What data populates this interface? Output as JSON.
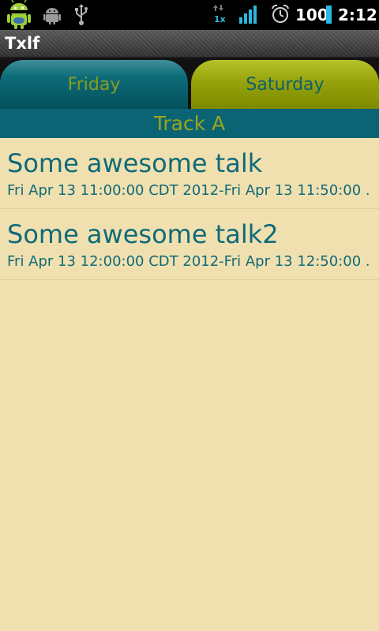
{
  "status_bar": {
    "battery": "100",
    "time": "2:12",
    "icons": [
      "android-notification-icon",
      "android-debug-icon",
      "usb-icon",
      "data-transfer-icon",
      "signal-bars-icon",
      "alarm-clock-icon",
      "battery-icon"
    ]
  },
  "app": {
    "title": "Txlf"
  },
  "tabs": [
    {
      "label": "Friday",
      "selected": false
    },
    {
      "label": "Saturday",
      "selected": true
    }
  ],
  "track": {
    "name": "Track A"
  },
  "talks": [
    {
      "title": "Some awesome talk",
      "time": "Fri Apr 13 11:00:00 CDT 2012-Fri Apr 13 11:50:00 ..."
    },
    {
      "title": "Some awesome talk2",
      "time": "Fri Apr 13 12:00:00 CDT 2012-Fri Apr 13 12:50:00 ..."
    }
  ],
  "colors": {
    "background": "#f0e0b0",
    "accent_teal": "#0a6474",
    "accent_olive": "#95a20a"
  }
}
